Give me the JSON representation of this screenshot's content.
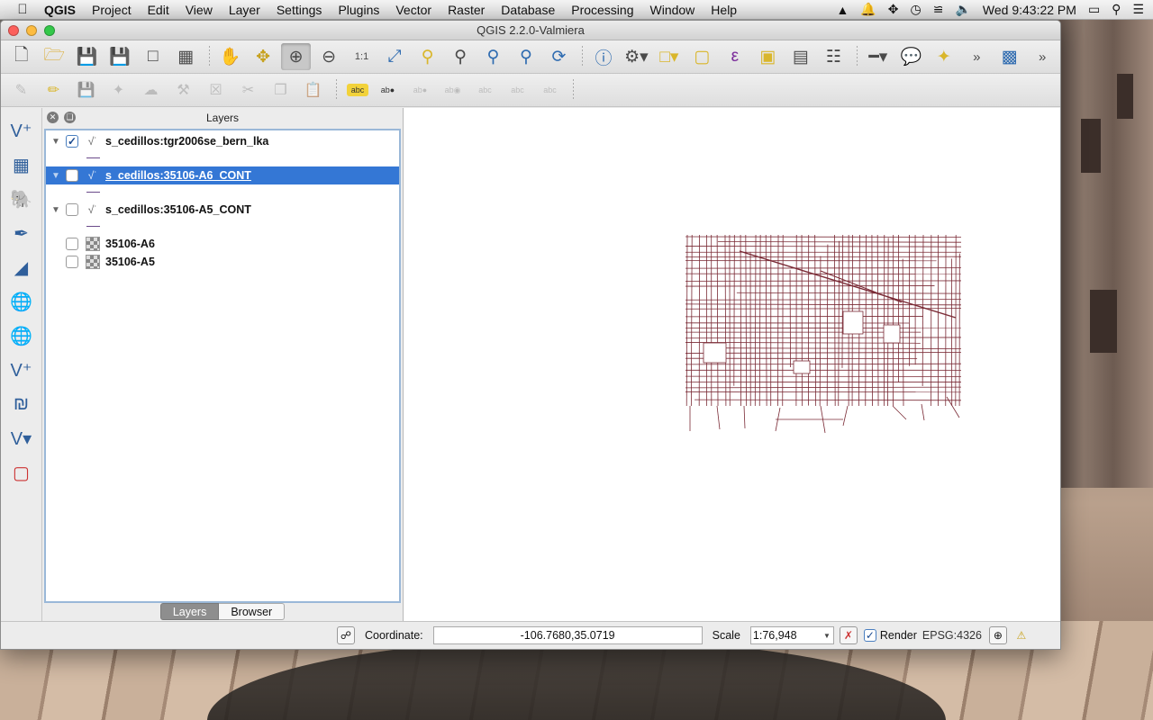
{
  "menubar": {
    "app_name": "QGIS",
    "items": [
      "Project",
      "Edit",
      "View",
      "Layer",
      "Settings",
      "Plugins",
      "Vector",
      "Raster",
      "Database",
      "Processing",
      "Window",
      "Help"
    ],
    "clock": "Wed 9:43:22 PM"
  },
  "window": {
    "title": "QGIS 2.2.0-Valmiera"
  },
  "layers_panel": {
    "title": "Layers",
    "layers": [
      {
        "name": "s_cedillos:tgr2006se_bern_lka",
        "checked": true,
        "type": "vector",
        "expanded": true,
        "selected": false
      },
      {
        "name": "s_cedillos:35106-A6_CONT",
        "checked": false,
        "type": "vector",
        "expanded": true,
        "selected": true
      },
      {
        "name": "s_cedillos:35106-A5_CONT",
        "checked": false,
        "type": "vector",
        "expanded": true,
        "selected": false
      },
      {
        "name": "35106-A6",
        "checked": false,
        "type": "raster",
        "expanded": false,
        "selected": false
      },
      {
        "name": "35106-A5",
        "checked": false,
        "type": "raster",
        "expanded": false,
        "selected": false
      }
    ],
    "tabs": [
      "Layers",
      "Browser"
    ],
    "active_tab": "Layers"
  },
  "statusbar": {
    "coordinate_label": "Coordinate:",
    "coordinate_value": "-106.7680,35.0719",
    "scale_label": "Scale",
    "scale_value": "1:76,948",
    "render_label": "Render",
    "render_checked": true,
    "crs": "EPSG:4326"
  },
  "colors": {
    "map_lines": "#7a2a35",
    "selection": "#3477d5"
  }
}
